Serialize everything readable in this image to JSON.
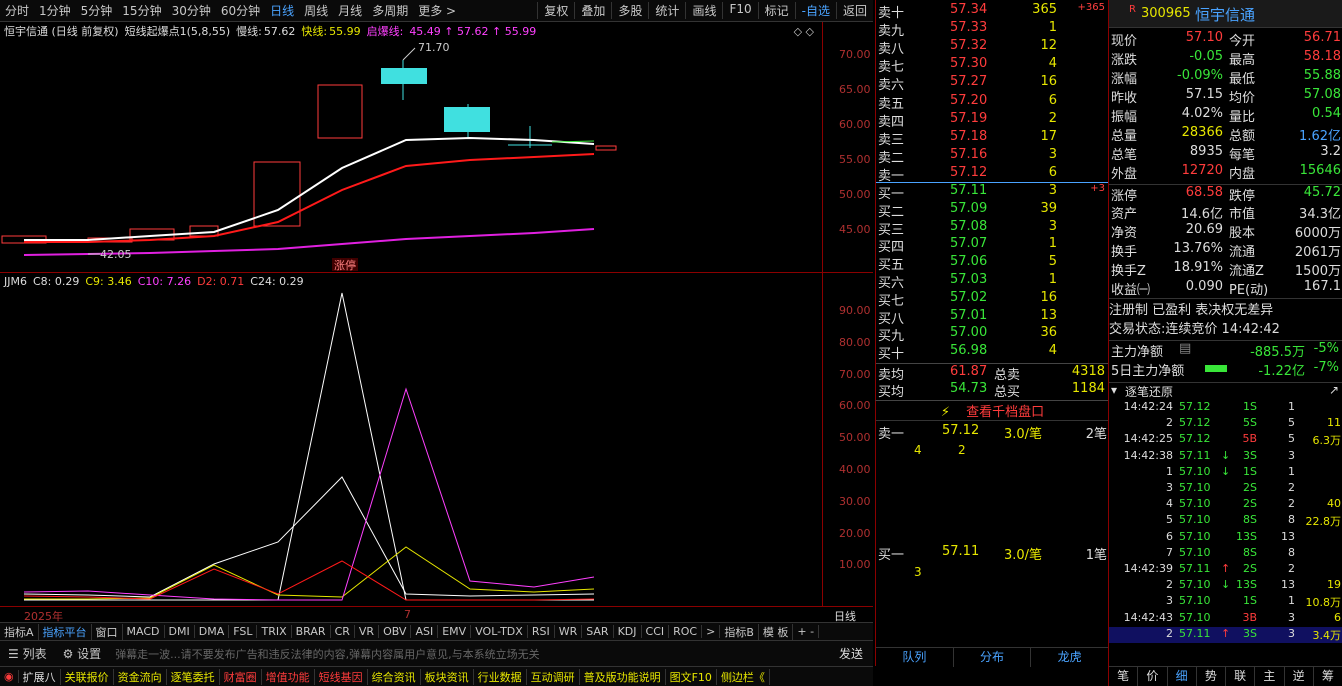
{
  "toolbar": {
    "timeframes": [
      "分时",
      "1分钟",
      "5分钟",
      "15分钟",
      "30分钟",
      "60分钟",
      "日线",
      "周线",
      "月线",
      "多周期",
      "更多 >"
    ],
    "active_timeframe": "日线",
    "tools": [
      "复权",
      "叠加",
      "多股",
      "统计",
      "画线",
      "F10",
      "标记",
      "-自选",
      "返回"
    ]
  },
  "chart_info": {
    "title": "恒宇信通 (日线 前复权)",
    "indicator": "短线起爆点1(5,8,55)",
    "slow_label": "慢线:",
    "slow_value": "57.62",
    "fast_label": "快线:",
    "fast_value": "55.99",
    "boom_label": "启爆线:",
    "boom_values": "45.49 ↑ 57.62 ↑ 55.99"
  },
  "kchart": {
    "high_label": "71.70",
    "low_label": "42.05",
    "tag": "涨停",
    "yticks": [
      "70.00",
      "65.00",
      "60.00",
      "55.00",
      "50.00",
      "45.00"
    ]
  },
  "indicator_info": {
    "name": "JJM6",
    "c8": "C8: 0.29",
    "c9": "C9: 3.46",
    "c10": "C10: 7.26",
    "d2": "D2: 0.71",
    "c24": "C24: 0.29",
    "yticks": [
      "90.00",
      "80.00",
      "70.00",
      "60.00",
      "50.00",
      "40.00",
      "30.00",
      "20.00",
      "10.00"
    ]
  },
  "xaxis": {
    "year": "2025年",
    "month": "7",
    "right": "日线"
  },
  "indicator_tabs": [
    "指标A",
    "指标平台",
    "窗口",
    "MACD",
    "DMI",
    "DMA",
    "FSL",
    "TRIX",
    "BRAR",
    "CR",
    "VR",
    "OBV",
    "ASI",
    "EMV",
    "VOL-TDX",
    "RSI",
    "WR",
    "SAR",
    "KDJ",
    "CCI",
    "ROC",
    ">",
    "指标B",
    "模 板",
    "+ -"
  ],
  "msgbar": {
    "list": "列表",
    "settings": "设置",
    "placeholder": "弹幕走一波...请不要发布广告和违反法律的内容,弹幕内容属用户意见,与本系统立场无关",
    "send": "发送"
  },
  "bottom_tabs": [
    "扩展八",
    "关联报价",
    "资金流向",
    "逐笔委托",
    "财富圈",
    "增值功能",
    "短线基因",
    "综合资讯",
    "板块资讯",
    "行业数据",
    "互动调研",
    "普及版功能说明",
    "图文F10",
    "侧边栏《"
  ],
  "orderbook": {
    "asks": [
      {
        "lb": "卖十",
        "p": "57.34",
        "v": "365",
        "ex": "+365"
      },
      {
        "lb": "卖九",
        "p": "57.33",
        "v": "1"
      },
      {
        "lb": "卖八",
        "p": "57.32",
        "v": "12"
      },
      {
        "lb": "卖七",
        "p": "57.30",
        "v": "4"
      },
      {
        "lb": "卖六",
        "p": "57.27",
        "v": "16"
      },
      {
        "lb": "卖五",
        "p": "57.20",
        "v": "6"
      },
      {
        "lb": "卖四",
        "p": "57.19",
        "v": "2"
      },
      {
        "lb": "卖三",
        "p": "57.18",
        "v": "17"
      },
      {
        "lb": "卖二",
        "p": "57.16",
        "v": "3"
      },
      {
        "lb": "卖一",
        "p": "57.12",
        "v": "6"
      }
    ],
    "bids": [
      {
        "lb": "买一",
        "p": "57.11",
        "v": "3",
        "ex": "+3"
      },
      {
        "lb": "买二",
        "p": "57.09",
        "v": "39"
      },
      {
        "lb": "买三",
        "p": "57.08",
        "v": "3"
      },
      {
        "lb": "买四",
        "p": "57.07",
        "v": "1"
      },
      {
        "lb": "买五",
        "p": "57.06",
        "v": "5"
      },
      {
        "lb": "买六",
        "p": "57.03",
        "v": "1"
      },
      {
        "lb": "买七",
        "p": "57.02",
        "v": "16"
      },
      {
        "lb": "买八",
        "p": "57.01",
        "v": "13"
      },
      {
        "lb": "买九",
        "p": "57.00",
        "v": "36"
      },
      {
        "lb": "买十",
        "p": "56.98",
        "v": "4"
      }
    ],
    "sell_avg_label": "卖均",
    "sell_avg": "61.87",
    "total_sell_label": "总卖",
    "total_sell": "4318",
    "buy_avg_label": "买均",
    "buy_avg": "54.73",
    "total_buy_label": "总买",
    "total_buy": "1184"
  },
  "mid": {
    "link": "查看千档盘口",
    "sell1_label": "卖一",
    "sell1_price": "57.12",
    "sell1_vol": "3.0/笔",
    "sell1_count": "2笔",
    "sell_q1": "4",
    "sell_q2": "2",
    "buy1_label": "买一",
    "buy1_price": "57.11",
    "buy1_vol": "3.0/笔",
    "buy1_count": "1笔",
    "buy_q1": "3"
  },
  "bottom_mid_tabs": [
    "队列",
    "分布",
    "龙虎"
  ],
  "quote": {
    "code": "300965",
    "name": "恒宇信通",
    "rows": [
      [
        "现价",
        "57.10",
        "今开",
        "56.71"
      ],
      [
        "涨跌",
        "-0.05",
        "最高",
        "58.18"
      ],
      [
        "涨幅",
        "-0.09%",
        "最低",
        "55.88"
      ],
      [
        "昨收",
        "57.15",
        "均价",
        "57.08"
      ],
      [
        "振幅",
        "4.02%",
        "量比",
        "0.54"
      ],
      [
        "总量",
        "28366",
        "总额",
        "1.62亿"
      ],
      [
        "总笔",
        "8935",
        "每笔",
        "3.2"
      ],
      [
        "外盘",
        "12720",
        "内盘",
        "15646"
      ],
      [
        "涨停",
        "68.58",
        "跌停",
        "45.72"
      ],
      [
        "资产",
        "14.6亿",
        "市值",
        "34.3亿"
      ],
      [
        "净资",
        "20.69",
        "股本",
        "6000万"
      ],
      [
        "换手",
        "13.76%",
        "流通",
        "2061万"
      ],
      [
        "换手Z",
        "18.91%",
        "流通Z",
        "1500万"
      ],
      [
        "收益㈠",
        "0.090",
        "PE(动)",
        "167.1"
      ]
    ],
    "tags": "注册制 已盈利 表决权无差异",
    "status_label": "交易状态:",
    "status": "连续竞价",
    "status_time": "14:42:42",
    "main_net_label": "主力净额",
    "main_net": "-885.5万",
    "main_net_pct": "-5%",
    "main5_label": "5日主力净额",
    "main5": "-1.22亿",
    "main5_pct": "-7%"
  },
  "ticks": {
    "title": "逐笔还原",
    "rows": [
      [
        "14:42:24",
        "57.12",
        "",
        "1S",
        "1",
        ""
      ],
      [
        "2",
        "57.12",
        "",
        "5S",
        "5",
        "11"
      ],
      [
        "14:42:25",
        "57.12",
        "",
        "5B",
        "5",
        "6.3万"
      ],
      [
        "14:42:38",
        "57.11",
        "↓",
        "3S",
        "3",
        ""
      ],
      [
        "1",
        "57.10",
        "↓",
        "1S",
        "1",
        ""
      ],
      [
        "3",
        "57.10",
        "",
        "2S",
        "2",
        ""
      ],
      [
        "4",
        "57.10",
        "",
        "2S",
        "2",
        "40"
      ],
      [
        "5",
        "57.10",
        "",
        "8S",
        "8",
        "22.8万"
      ],
      [
        "6",
        "57.10",
        "",
        "13S",
        "13",
        ""
      ],
      [
        "7",
        "57.10",
        "",
        "8S",
        "8",
        ""
      ],
      [
        "14:42:39",
        "57.11",
        "↑",
        "2S",
        "2",
        ""
      ],
      [
        "2",
        "57.10",
        "↓",
        "13S",
        "13",
        "19"
      ],
      [
        "3",
        "57.10",
        "",
        "1S",
        "1",
        "10.8万"
      ],
      [
        "14:42:43",
        "57.10",
        "",
        "3B",
        "3",
        "6"
      ],
      [
        "2",
        "57.11",
        "↑",
        "3S",
        "3",
        "3.4万"
      ]
    ]
  },
  "right_bottom_tabs": [
    "笔",
    "价",
    "细",
    "势",
    "联",
    "主",
    "逆",
    "筹"
  ]
}
